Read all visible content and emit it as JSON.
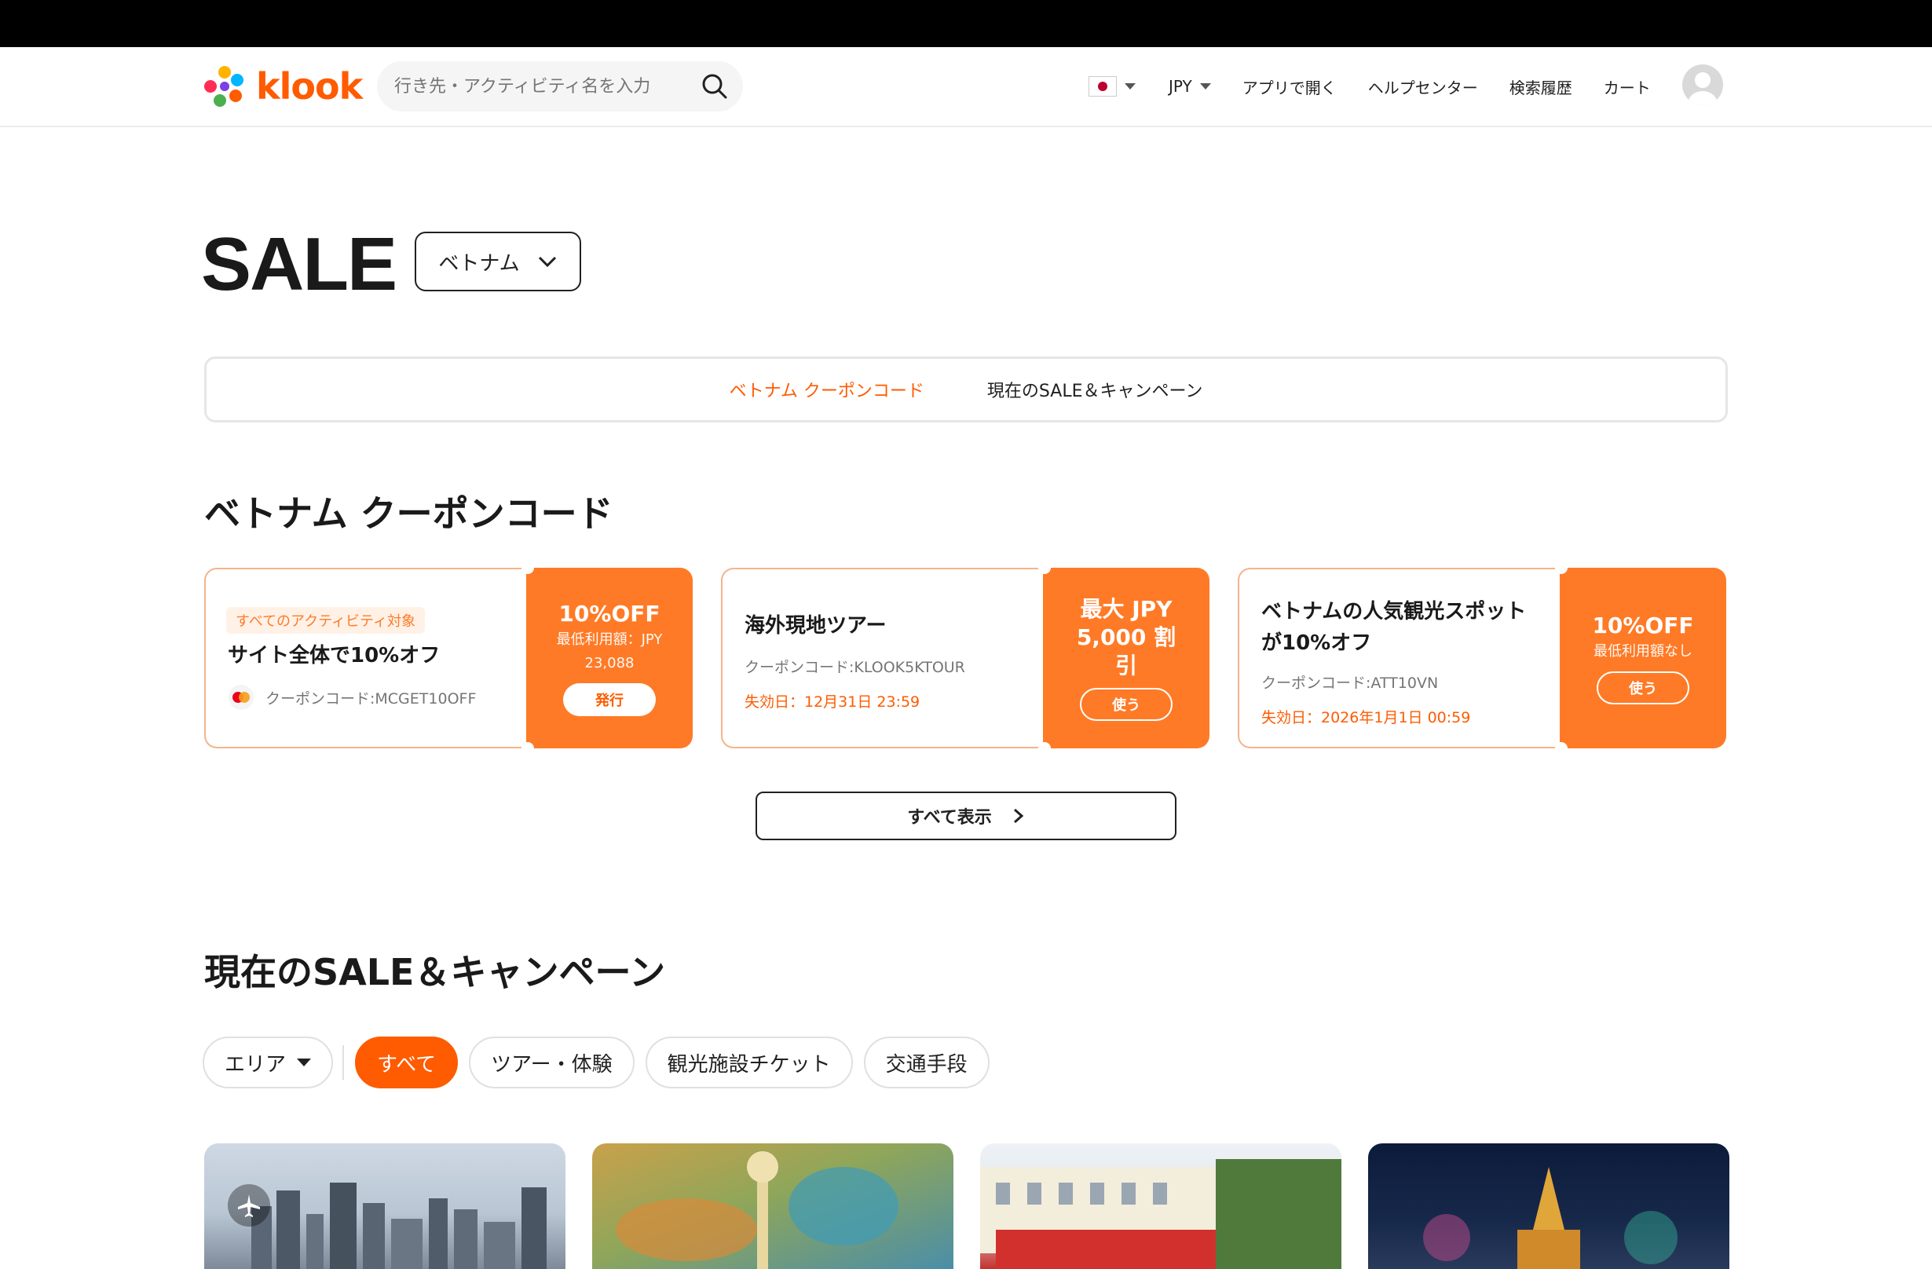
{
  "header": {
    "logo_text": "klook",
    "search_placeholder": "行き先・アクティビティ名を入力",
    "currency": "JPY",
    "nav": [
      "アプリで開く",
      "ヘルプセンター",
      "検索履歴",
      "カート"
    ]
  },
  "page": {
    "title": "SALE",
    "country": "ベトナム"
  },
  "tabs": [
    {
      "label": "ベトナム クーポンコード",
      "active": true
    },
    {
      "label": "現在のSALE＆キャンペーン",
      "active": false
    }
  ],
  "coupons_section": {
    "title": "ベトナム クーポンコード",
    "view_all": "すべて表示"
  },
  "coupons": [
    {
      "badge": "すべてのアクティビティ対象",
      "title": "サイト全体で10%オフ",
      "code": "クーポンコード:MCGET10OFF",
      "deal": "10%OFF",
      "min": "最低利用額：JPY 23,088",
      "button": "発行"
    },
    {
      "title": "海外現地ツアー",
      "code": "クーポンコード:KLOOK5KTOUR",
      "expiry": "失効日：12月31日 23:59",
      "deal": "最大 JPY 5,000 割引",
      "button": "使う"
    },
    {
      "title": "ベトナムの人気観光スポットが10%オフ",
      "code": "クーポンコード:ATT10VN",
      "expiry": "失効日：2026年1月1日 00:59",
      "deal": "10%OFF",
      "min": "最低利用額なし",
      "button": "使う"
    }
  ],
  "campaign_section": {
    "title": "現在のSALE＆キャンペーン"
  },
  "filters": [
    {
      "label": "エリア",
      "dropdown": true
    },
    {
      "label": "すべて",
      "active": true
    },
    {
      "label": "ツアー・体験"
    },
    {
      "label": "観光施設チケット"
    },
    {
      "label": "交通手段"
    }
  ],
  "colors": {
    "brand": "#ff5b00",
    "coupon_fill": "#ff7a26"
  }
}
